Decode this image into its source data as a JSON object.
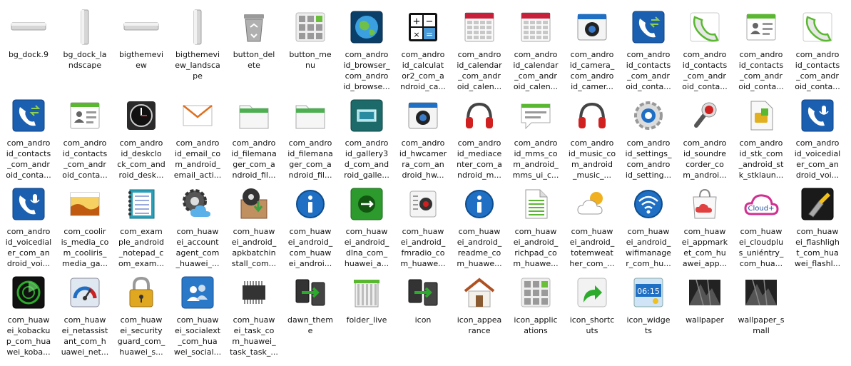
{
  "icons": [
    {
      "icon": "dock-bar-icon",
      "label": "bg_dock.9",
      "color": "#b8b8b8"
    },
    {
      "icon": "dock-bar-vertical-icon",
      "label": "bg_dock_la\nndscape",
      "color": "#b8b8b8"
    },
    {
      "icon": "dock-bar-icon",
      "label": "bigthemevi\new",
      "color": "#b8b8b8"
    },
    {
      "icon": "dock-bar-vertical-icon",
      "label": "bigthemevi\new_landsca\npe",
      "color": "#b8b8b8"
    },
    {
      "icon": "recycle-bin-icon",
      "label": "button_del\nete",
      "color": "#8c8c8c"
    },
    {
      "icon": "menu-grid-icon",
      "label": "button_me\nnu",
      "color": "#8a8a8a"
    },
    {
      "icon": "globe-browser-icon",
      "label": "com_andro\nid_browser_\ncom_andro\nid_browse...",
      "color": "#1e7fc0"
    },
    {
      "icon": "calculator-icon",
      "label": "com_andro\nid_calculat\nor2_com_a\nndroid_ca...",
      "color": "#1a1a1a"
    },
    {
      "icon": "calendar-icon",
      "label": "com_andro\nid_calendar\n_com_andr\noid_calen...",
      "color": "#c8203a"
    },
    {
      "icon": "calendar-icon",
      "label": "com_andro\nid_calendar\n_com_andr\noid_calen...",
      "color": "#c8203a"
    },
    {
      "icon": "camera-icon",
      "label": "com_andro\nid_camera_\ncom_andro\nid_camer...",
      "color": "#1f6fc4"
    },
    {
      "icon": "contacts-phone-icon",
      "label": "com_andro\nid_contacts\n_com_andr\noid_conta...",
      "color": "#1b5fb0"
    },
    {
      "icon": "phone-handset-icon",
      "label": "com_andro\nid_contacts\n_com_andr\noid_conta...",
      "color": "#5ab830"
    },
    {
      "icon": "contact-card-icon",
      "label": "com_andro\nid_contacts\n_com_andr\noid_conta...",
      "color": "#5ab830"
    },
    {
      "icon": "phone-handset-icon",
      "label": "com_andro\nid_contacts\n_com_andr\noid_conta...",
      "color": "#5ab830"
    },
    {
      "icon": "contacts-phone-icon",
      "label": "com_andro\nid_contacts\n_com_andr\noid_conta...",
      "color": "#1b5fb0"
    },
    {
      "icon": "contact-card-icon",
      "label": "com_andro\nid_contacts\n_com_andr\noid_conta...",
      "color": "#5ab830"
    },
    {
      "icon": "desk-clock-icon",
      "label": "com_andro\nid_deskclo\nck_com_and\nroid_desk...",
      "color": "#222222"
    },
    {
      "icon": "email-envelope-icon",
      "label": "com_andro\nid_email_co\nm_android_\nemail_acti...",
      "color": "#e07020"
    },
    {
      "icon": "folder-icon",
      "label": "com_andro\nid_filemana\nger_com_a\nndroid_fil...",
      "color": "#4caf50"
    },
    {
      "icon": "folder-icon",
      "label": "com_andro\nid_filemana\nger_com_a\nndroid_fil...",
      "color": "#4caf50"
    },
    {
      "icon": "gallery-icon",
      "label": "com_andro\nid_gallery3\nd_com_and\nroid_galle...",
      "color": "#1d7a7a"
    },
    {
      "icon": "camera-icon",
      "label": "com_andro\nid_hwcamer\nra_com_an\ndroid_hw...",
      "color": "#1f6fc4"
    },
    {
      "icon": "headphones-icon",
      "label": "com_andro\nid_mediace\nnter_com_a\nndroid_m...",
      "color": "#d02020"
    },
    {
      "icon": "message-bubble-icon",
      "label": "com_andro\nid_mms_co\nm_android_\nmms_ui_c...",
      "color": "#5ab830"
    },
    {
      "icon": "headphones-icon",
      "label": "com_andro\nid_music_co\nm_android\n_music_...",
      "color": "#d02020"
    },
    {
      "icon": "settings-gear-icon",
      "label": "com_andro\nid_settings_\ncom_andro\nid_setting...",
      "color": "#1f6fc4"
    },
    {
      "icon": "microphone-icon",
      "label": "com_andro\nid_soundre\ncorder_co\nm_androi...",
      "color": "#d02020"
    },
    {
      "icon": "sim-card-icon",
      "label": "com_andro\nid_stk_com\n_android_st\nk_stklaun...",
      "color": "#e0b020"
    },
    {
      "icon": "voice-dialer-icon",
      "label": "com_andro\nid_voicedial\ner_com_an\ndroid_voi...",
      "color": "#1b5fb0"
    },
    {
      "icon": "voice-dialer-icon",
      "label": "com_andro\nid_voicedial\ner_com_an\ndroid_voi...",
      "color": "#1b5fb0"
    },
    {
      "icon": "landscape-media-icon",
      "label": "com_coolir\nis_media_co\nm_cooliris_\nmedia_ga...",
      "color": "#e08020"
    },
    {
      "icon": "notepad-icon",
      "label": "com_exam\nple_android\n_notepad_c\nom_exam...",
      "color": "#1f8fa0"
    },
    {
      "icon": "account-cloud-gear-icon",
      "label": "com_huaw\nei_account\nagent_com\n_huawei_...",
      "color": "#444444"
    },
    {
      "icon": "apk-install-box-icon",
      "label": "com_huaw\nei_android_\napkbatchin\nstall_com...",
      "color": "#3aa040"
    },
    {
      "icon": "info-circle-icon",
      "label": "com_huaw\nei_android_\ncom_huaw\nei_androi...",
      "color": "#1f6fc4"
    },
    {
      "icon": "dlna-icon",
      "label": "com_huaw\nei_android_\ndlna_com_\nhuawei_a...",
      "color": "#2c9a2c"
    },
    {
      "icon": "fm-radio-icon",
      "label": "com_huaw\nei_android_\nfmradio_co\nm_huawe...",
      "color": "#d02020"
    },
    {
      "icon": "info-circle-icon",
      "label": "com_huaw\nei_android_\nreadme_co\nm_huawe...",
      "color": "#1f6fc4"
    },
    {
      "icon": "document-icon",
      "label": "com_huaw\nei_android_\nrichpad_co\nm_huawe...",
      "color": "#5ab830"
    },
    {
      "icon": "weather-cloud-icon",
      "label": "com_huaw\nei_android_\ntotemweat\nher_com_...",
      "color": "#f0b020"
    },
    {
      "icon": "wifi-icon",
      "label": "com_huaw\nei_android_\nwifimanage\nr_com_hu...",
      "color": "#1f6fc4"
    },
    {
      "icon": "app-market-bag-icon",
      "label": "com_huaw\nei_appmark\net_com_hu\nawei_app...",
      "color": "#e04040"
    },
    {
      "icon": "cloud-plus-icon",
      "label": "com_huaw\nei_cloudplu\ns_uniéntry_\ncom_hua...",
      "color": "#d03090"
    },
    {
      "icon": "flashlight-icon",
      "label": "com_huaw\nei_flashligh\nt_com_hua\nwei_flashl...",
      "color": "#f0c020"
    },
    {
      "icon": "backup-radar-icon",
      "label": "com_huaw\nei_kobacku\np_com_hua\nwei_koba...",
      "color": "#2caa2c"
    },
    {
      "icon": "speedometer-icon",
      "label": "com_huaw\nei_netassist\nant_com_h\nuawei_net...",
      "color": "#1f6fc4"
    },
    {
      "icon": "padlock-icon",
      "label": "com_huaw\nei_security\nguard_com_\nhuawei_s...",
      "color": "#e0a820"
    },
    {
      "icon": "social-contacts-icon",
      "label": "com_huaw\nei_socialext\n_com_hua\nwei_social...",
      "color": "#1f6fc4"
    },
    {
      "icon": "chip-icon",
      "label": "com_huaw\nei_task_co\nm_huawei_\ntask_task_...",
      "color": "#333333"
    },
    {
      "icon": "phone-switch-icon",
      "label": "dawn_them\ne",
      "color": "#2caa2c"
    },
    {
      "icon": "folder-live-icon",
      "label": "folder_live",
      "color": "#7a7a7a"
    },
    {
      "icon": "phone-switch-icon",
      "label": "icon",
      "color": "#2caa2c"
    },
    {
      "icon": "house-icon",
      "label": "icon_appea\nrance",
      "color": "#b05020"
    },
    {
      "icon": "menu-grid-icon",
      "label": "icon_applic\nations",
      "color": "#8a8a8a"
    },
    {
      "icon": "shortcut-arrow-icon",
      "label": "icon_shortc\nuts",
      "color": "#2caa2c"
    },
    {
      "icon": "widget-clock-icon",
      "label": "icon_widge\nts",
      "color": "#1f6fc4"
    },
    {
      "icon": "wallpaper-image-icon",
      "label": "wallpaper",
      "color": "#333333"
    },
    {
      "icon": "wallpaper-image-icon",
      "label": "wallpaper_s\nmall",
      "color": "#333333"
    }
  ]
}
